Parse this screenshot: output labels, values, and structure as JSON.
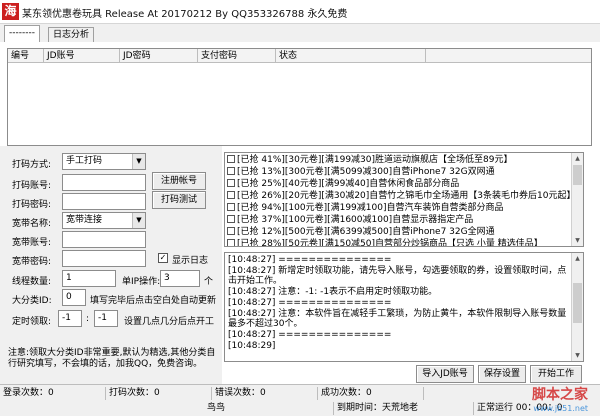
{
  "titlebar": {
    "icon_glyph": "海",
    "title": "某东领优惠卷玩具 Release At 20170212 By QQ353326788 永久免费"
  },
  "tabs": [
    {
      "label": "--------"
    },
    {
      "label": "日志分析"
    }
  ],
  "grid": {
    "columns": [
      "编号",
      "JD账号",
      "JD密码",
      "支付密码",
      "状态"
    ]
  },
  "form": {
    "method_label": "打码方式:",
    "method_value": "手工打码",
    "account_label": "打码账号:",
    "password_label": "打码密码:",
    "register_btn": "注册帐号",
    "test_btn": "打码测试",
    "broadband_name_label": "宽带名称:",
    "broadband_name_value": "宽带连接",
    "broadband_account_label": "宽带账号:",
    "broadband_password_label": "宽带密码:",
    "show_log_label": "显示日志",
    "threads_label": "线程数量:",
    "threads_value": "1",
    "single_account_label": "单IP操作:",
    "single_account_value": "3",
    "single_account_unit": "个",
    "category_label": "大分类ID:",
    "category_value": "0",
    "category_hint": "填写完毕后点击空白处自动更新",
    "timer_label": "定时领取:",
    "timer_hour": "-1",
    "timer_colon": ":",
    "timer_minute": "-1",
    "timer_hint": "设置几点几分后点开工"
  },
  "coupons": [
    "[已抢 41%][30元卷][满199减30]胜道运动旗舰店【全场低至89元】",
    "[已抢 13%][300元卷][满5099减300]自营iPhone7 32G双网通",
    "[已抢 25%][40元卷][满99减40]自营休闲食品部分商品",
    "[已抢 26%][20元卷][满30减20]自营竹之锦毛巾全场通用【3条装毛巾券后10元起】",
    "[已抢 94%][100元卷][满199减100]自营汽车装饰自营类部分商品",
    "[已抢 37%][100元卷][满1600减100]自营显示器指定产品",
    "[已抢 12%][500元卷][满6399减500]自营iPhone7 32G全网通",
    "[已抢 28%][50元卷][满150减50]自营部分炒锅商品【只选 小量 精选佳品】"
  ],
  "log": [
    "[10:48:27] ===============",
    "[10:48:27] 新增定时领取功能，请先导入账号，勾选要领取的券，设置领取时间，点击开始工作。",
    "[10:48:27] 注意：-1: -1表示不启用定时领取功能。",
    "[10:48:27] ===============",
    "[10:48:27] 注意：本软件旨在减轻手工繁琐，为防止黄牛，本软件限制导入账号数量最多不超过30个。",
    "[10:48:27] ===============",
    "[10:48:29]"
  ],
  "notice": "注意:领取大分类ID非常重要,默认为精选,其他分类自行研究填写，不会填的话，加我QQ，免费咨询。",
  "actions": {
    "import_btn": "导入JD账号",
    "save_btn": "保存设置",
    "start_btn": "开始工作"
  },
  "statusbar": {
    "login_count": "登录次数：0",
    "captcha_count": "打码次数：0",
    "error_count": "错误次数：0",
    "success_count": "成功次数：0",
    "bottom_center": "鸟鸟",
    "expire": "到期时间：天荒地老",
    "normal": "正常运行 00：00：0"
  },
  "watermark": {
    "text": "脚本之家",
    "url": "www.jb51.net"
  }
}
